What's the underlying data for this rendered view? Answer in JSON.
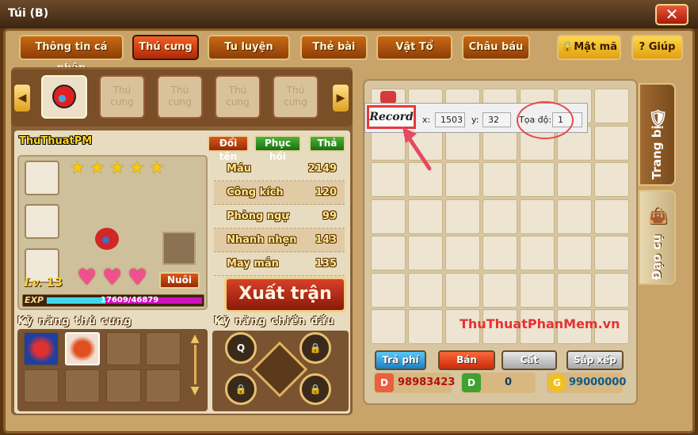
{
  "window": {
    "title": "Túi (B)",
    "close_icon": "close-x-icon"
  },
  "tabs": [
    {
      "label": "Thông tin cá nhân"
    },
    {
      "label": "Thú cưng",
      "active": true
    },
    {
      "label": "Tu luyện"
    },
    {
      "label": "Thẻ bài"
    },
    {
      "label": "Vật Tổ"
    },
    {
      "label": "Châu báu"
    },
    {
      "label": "Mật mã",
      "icon": "lock-icon"
    },
    {
      "label": "Giúp",
      "icon": "question-icon"
    }
  ],
  "pets": {
    "slots": [
      "",
      "Thú cưng",
      "Thú cưng",
      "Thú cưng",
      "Thú cưng"
    ]
  },
  "pet": {
    "name": "ThuThuatPM",
    "rename": "Đổi tên",
    "restore": "Phục hồi",
    "release": "Thả",
    "stars": 5,
    "hearts": 3,
    "level_label": "Lv.",
    "level": "13",
    "feed": "Nuôi",
    "exp_label": "EXP",
    "exp": "17609/46879",
    "exp_current": 17609,
    "exp_max": 46879
  },
  "stats": [
    {
      "label": "Máu",
      "value": "2149"
    },
    {
      "label": "Công kích",
      "value": "120"
    },
    {
      "label": "Phòng ngự",
      "value": "99"
    },
    {
      "label": "Nhanh nhẹn",
      "value": "143"
    },
    {
      "label": "May mắn",
      "value": "135"
    }
  ],
  "deploy": "Xuất trận",
  "pet_skills_label": "Kỹ năng thú cưng",
  "battle_skills_label": "Kỹ năng chiến đấu",
  "battle_skills": [
    "Q"
  ],
  "side_tabs": {
    "equipment": "Trang bị",
    "items": "Đạo cụ"
  },
  "record": {
    "button": "Record",
    "x_label": "x:",
    "x": "1503",
    "y_label": "y:",
    "y": "32",
    "coord_label": "Tọa độ:",
    "coord": "1"
  },
  "bottom": {
    "pay": "Trả phí",
    "sell": "Bán",
    "store": "Cất",
    "sort": "Sắp xếp"
  },
  "currency": {
    "ruby": "98983423",
    "dollar": "0",
    "gold": "99000000"
  },
  "watermark": "ThuThuatPhanMem.vn",
  "colors": {
    "accent": "#e8302a",
    "tab_active": "#d8401a",
    "exp_cyan": "#40d8e8",
    "exp_magenta": "#d010c0"
  }
}
